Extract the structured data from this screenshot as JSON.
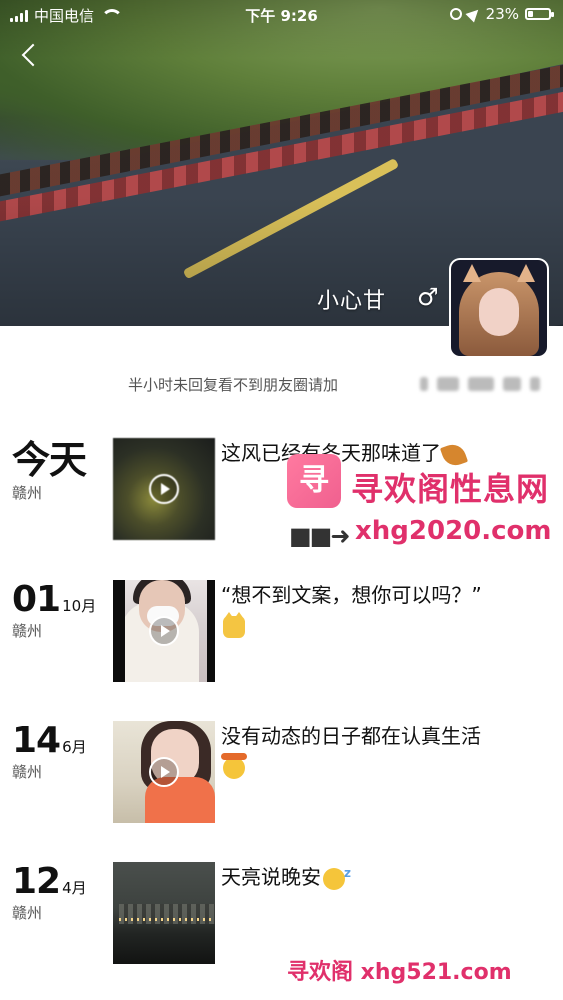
{
  "status_bar": {
    "carrier": "中国电信",
    "time": "下午 9:26",
    "battery": "23%"
  },
  "profile": {
    "nickname": "小心甘",
    "gender_icon": "male-icon",
    "signature": "半小时未回复看不到朋友圈请加"
  },
  "moments": [
    {
      "day": "今天",
      "month": "",
      "place": "赣州",
      "text": "这风已经有冬天那味道了",
      "emoji": "leaf-icon",
      "media": "video"
    },
    {
      "day": "01",
      "month": "10月",
      "place": "赣州",
      "text": "“想不到文案，想你可以吗？”",
      "emoji": "cat-icon",
      "media": "video"
    },
    {
      "day": "14",
      "month": "6月",
      "place": "赣州",
      "text": "没有动态的日子都在认真生活",
      "emoji": "sweat-icon",
      "media": "video"
    },
    {
      "day": "12",
      "month": "4月",
      "place": "赣州",
      "text": "天亮说晚安",
      "emoji": "sleep-icon",
      "media": "image"
    }
  ],
  "watermark": {
    "logo_text": "寻欢",
    "title": "寻欢阁性息网",
    "arrow": "■■➜",
    "url": "xhg2020.com",
    "bottom": "寻欢阁 xhg521.com"
  },
  "colors": {
    "watermark": "#e0306b",
    "text": "#111111",
    "muted": "#555555"
  }
}
